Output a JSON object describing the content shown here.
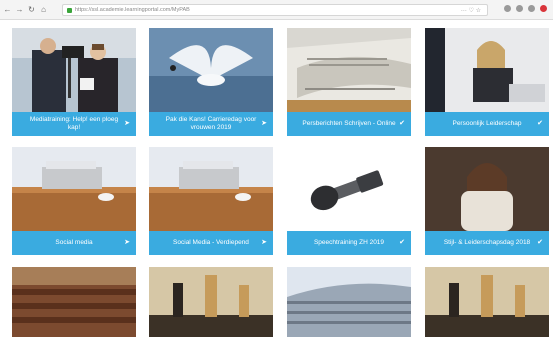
{
  "browser": {
    "url": "https://ssl.academie.learningportal.com/MyPAB",
    "url_menu": "··· ♡ ☆"
  },
  "cards": [
    {
      "title": "Mediatraining: Help! een ploeg kap!",
      "status_icon": "send-icon"
    },
    {
      "title": "Pak die Kans! Carrieredag voor vrouwen 2019",
      "status_icon": "send-icon"
    },
    {
      "title": "Persberichten Schrijven - Online",
      "status_icon": "check-icon"
    },
    {
      "title": "Persoonlijk Leiderschap",
      "status_icon": "check-icon"
    },
    {
      "title": "Social media",
      "status_icon": "send-icon"
    },
    {
      "title": "Social Media - Verdiepend",
      "status_icon": "send-icon"
    },
    {
      "title": "Speechtraining ZH 2019",
      "status_icon": "check-icon"
    },
    {
      "title": "Stijl- & Leiderschapsdag 2018",
      "status_icon": "check-icon"
    }
  ],
  "colors": {
    "caption": "#3aabe0"
  }
}
